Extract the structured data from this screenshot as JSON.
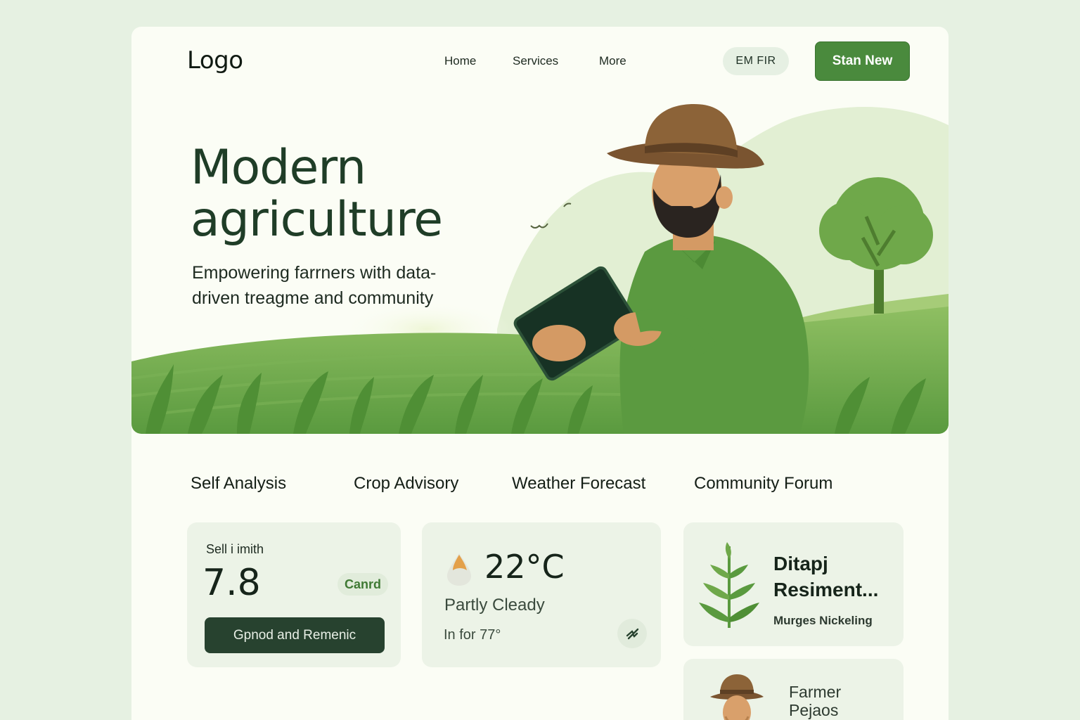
{
  "nav": {
    "logo": "Logo",
    "links": [
      "Home",
      "Services",
      "More"
    ],
    "language": "EM FIR",
    "cta": "Stan New"
  },
  "hero": {
    "title": "Modern agriculture",
    "subtitle": "Empowering farrners with data-driven treagme and community"
  },
  "tabs": [
    "Self Analysis",
    "Crop Advisory",
    "Weather Forecast",
    "Community Forum"
  ],
  "cards": {
    "soil": {
      "label": "Sell i imith",
      "value": "7.8",
      "badge": "Canrd",
      "button": "Gpnod and Remenic"
    },
    "weather": {
      "temperature": "22°C",
      "condition": "Partly Cleady",
      "detail": "In for 77°"
    },
    "crop": {
      "title": "Ditapj Resiment...",
      "subtitle": "Murges Nickeling"
    },
    "farmer": {
      "title": "Farmer Pejaos"
    }
  },
  "colors": {
    "accent": "#4a8a3d",
    "dark": "#27422f",
    "background": "#e6f1e2",
    "card": "#fbfdf5"
  }
}
